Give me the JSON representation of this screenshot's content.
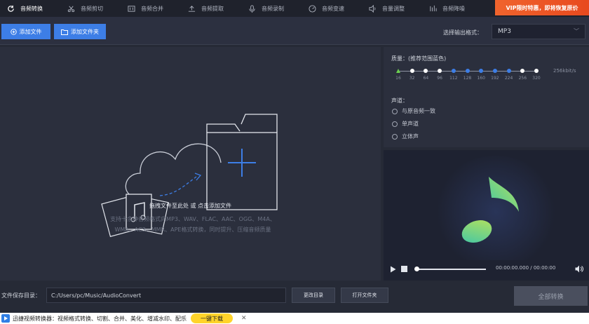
{
  "tabs": [
    {
      "label": "音频转换",
      "icon": "refresh-icon"
    },
    {
      "label": "音频剪切",
      "icon": "scissors-icon"
    },
    {
      "label": "音频合并",
      "icon": "merge-icon"
    },
    {
      "label": "音频提取",
      "icon": "upload-icon"
    },
    {
      "label": "音频录制",
      "icon": "microphone-icon"
    },
    {
      "label": "音频变速",
      "icon": "speed-icon"
    },
    {
      "label": "音量调整",
      "icon": "volume-icon"
    },
    {
      "label": "音频降噪",
      "icon": "equalizer-icon"
    }
  ],
  "vip_banner": "VIP限时特惠，即将恢复原价",
  "toolbar": {
    "add_file": "添加文件",
    "add_folder": "添加文件夹",
    "format_label": "选择输出格式：",
    "format_value": "MP3"
  },
  "dropzone": {
    "main_text": "拖拽文件至此处 或 点击添加文件",
    "sub_text_1": "支持十余种音频格式向MP3、WAV、FLAC、AAC、OGG、M4A、",
    "sub_text_2": "WMA、AC3、MMR、APE格式转换，同时提升、压缩音频质量"
  },
  "quality": {
    "title": "质量：(推荐范围蓝色)",
    "value": "256kbit/s",
    "ticks": [
      "16",
      "32",
      "64",
      "96",
      "112",
      "128",
      "160",
      "192",
      "224",
      "256",
      "320"
    ]
  },
  "channel": {
    "title": "声道：",
    "options": [
      "与原音频一致",
      "单声道",
      "立体声"
    ]
  },
  "player": {
    "time": "00:00:00.000 / 00:00:00"
  },
  "save": {
    "label": "文件保存目录：",
    "path": "C:/Users/pc/Music/AudioConvert",
    "change_dir": "更改目录",
    "open_folder": "打开文件夹",
    "convert_all": "全部转换"
  },
  "footer": {
    "text": "迅捷视频转换器：视频格式转换、切割、合并、美化、增减水印、配乐",
    "download": "一键下载"
  },
  "colors": {
    "accent": "#3d7ee6",
    "vip": "#e8491e",
    "green_note": "#7fd36b"
  }
}
